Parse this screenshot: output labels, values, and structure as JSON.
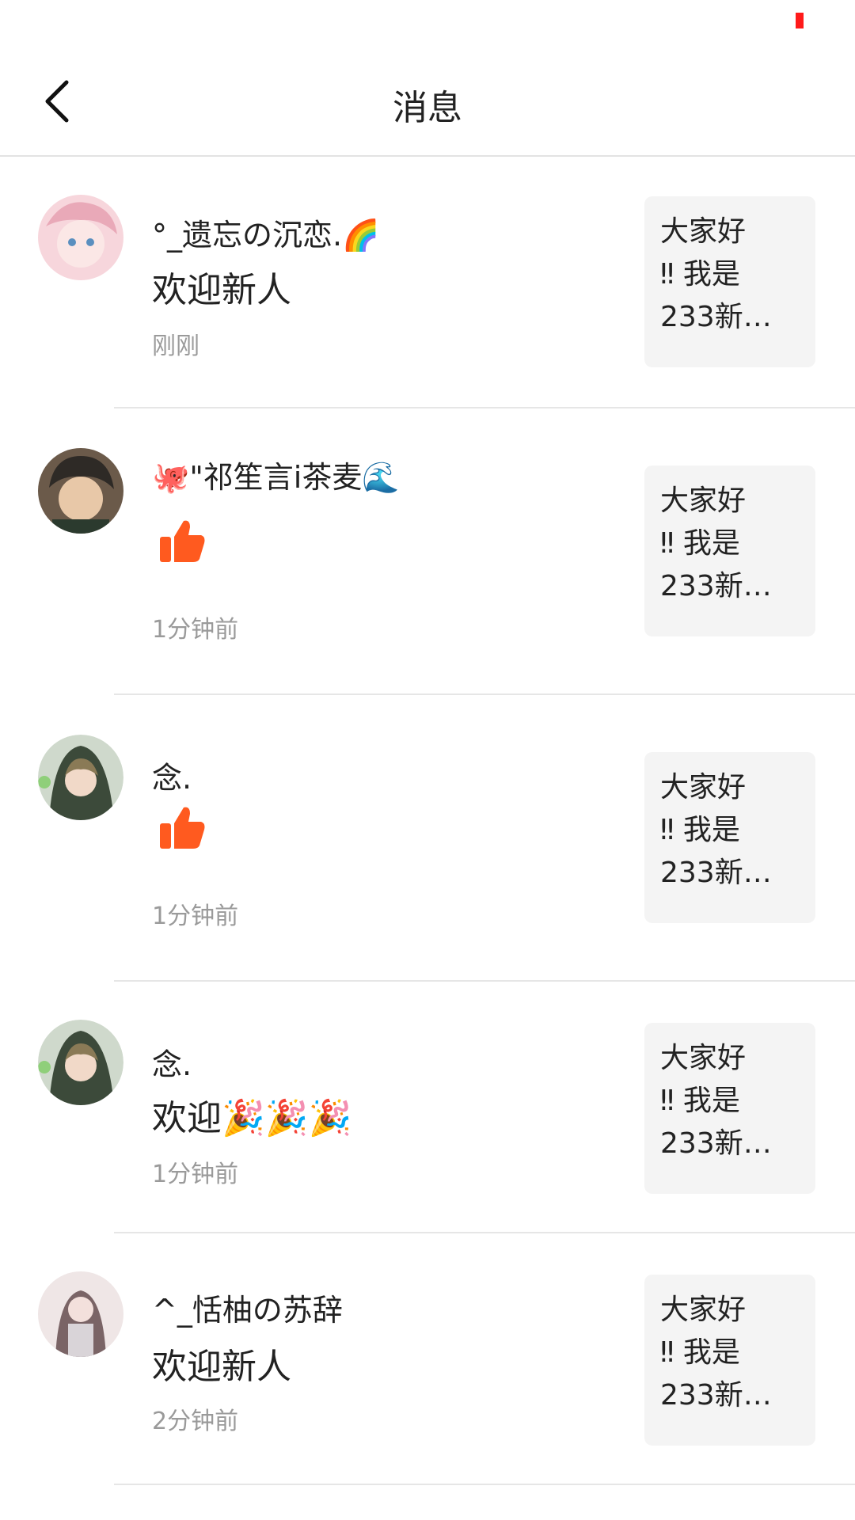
{
  "header": {
    "title": "消息"
  },
  "messages": [
    {
      "user": "°_遗忘の沉恋.",
      "user_emoji": "🌈",
      "text": "欢迎新人",
      "type": "comment",
      "time": "刚刚",
      "thumb": [
        "大家好",
        "‼ 我是",
        "233新…"
      ],
      "avatar_colors": [
        "#f7d6dc",
        "#e9a9b8"
      ]
    },
    {
      "user_prefix_emoji": "🐙",
      "user": "\"祁笙言i茶麦",
      "user_emoji": "🌊",
      "text": "",
      "type": "like",
      "time": "1分钟前",
      "thumb": [
        "大家好",
        "‼ 我是",
        "233新…"
      ],
      "avatar_colors": [
        "#5b4a3c",
        "#2e2a26"
      ]
    },
    {
      "user": "念.",
      "text": "",
      "type": "like",
      "time": "1分钟前",
      "thumb": [
        "大家好",
        "‼ 我是",
        "233新…"
      ],
      "avatar_colors": [
        "#9fb59a",
        "#3c4a3a"
      ]
    },
    {
      "user": "念.",
      "text": "欢迎🎉🎉🎉",
      "type": "comment",
      "time": "1分钟前",
      "thumb": [
        "大家好",
        "‼ 我是",
        "233新…"
      ],
      "avatar_colors": [
        "#9fb59a",
        "#3c4a3a"
      ]
    },
    {
      "user": "^_恬柚の苏辞",
      "text": "欢迎新人",
      "type": "comment",
      "time": "2分钟前",
      "thumb": [
        "大家好",
        "‼ 我是",
        "233新…"
      ],
      "avatar_colors": [
        "#e8d8d6",
        "#7a6466"
      ]
    }
  ],
  "colors": {
    "like_orange": "#ff5a1f",
    "status_red": "#ff1a1a",
    "divider": "#e6e6e6",
    "thumb_bg": "#f4f4f4"
  },
  "icons": {
    "back": "chevron-left-icon",
    "like": "thumbs-up-icon"
  }
}
